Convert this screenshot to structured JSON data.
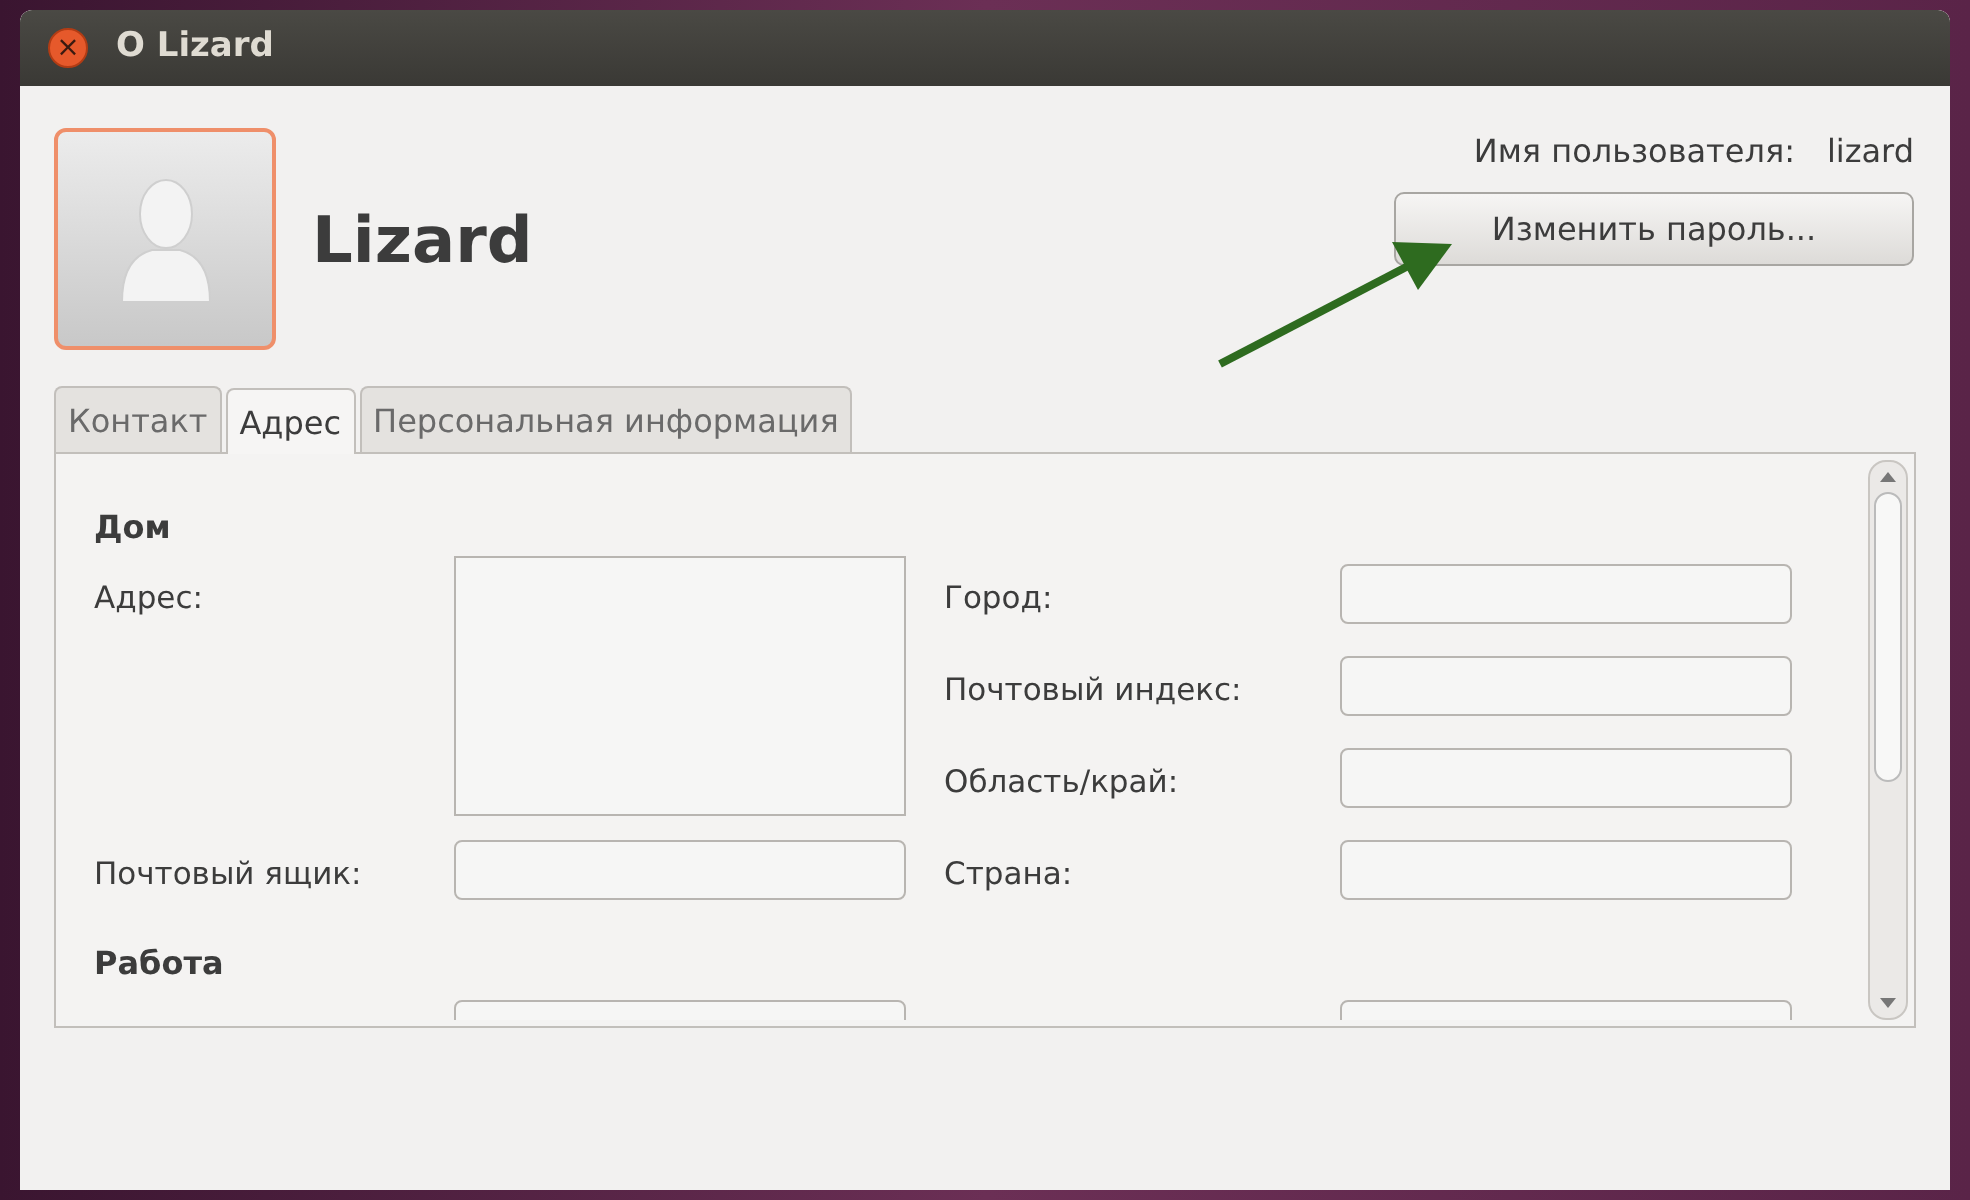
{
  "window": {
    "title": "О Lizard",
    "close_glyph": "×"
  },
  "user": {
    "display_name": "Lizard",
    "username_label": "Имя пользователя:",
    "username": "lizard",
    "change_password_button": "Изменить пароль..."
  },
  "annotation": {
    "kind": "arrow"
  },
  "tabs": [
    {
      "label": "Контакт",
      "selected": false
    },
    {
      "label": "Адрес",
      "selected": true
    },
    {
      "label": "Персональная информация",
      "selected": false
    }
  ],
  "sections": [
    {
      "heading": "Дом",
      "left": [
        {
          "label": "Адрес:",
          "kind": "multiline"
        },
        {
          "label": "Почтовый ящик:",
          "kind": "line"
        }
      ],
      "right": [
        {
          "label": "Город:",
          "kind": "line"
        },
        {
          "label": "Почтовый индекс:",
          "kind": "line"
        },
        {
          "label": "Область/край:",
          "kind": "line"
        },
        {
          "label": "Страна:",
          "kind": "line"
        }
      ]
    },
    {
      "heading": "Работа",
      "left": [
        {
          "kind": "cut"
        }
      ],
      "right": [
        {
          "kind": "cut"
        }
      ]
    }
  ]
}
